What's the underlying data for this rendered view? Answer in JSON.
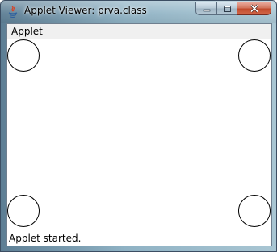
{
  "window": {
    "title": "Applet Viewer: prva.class",
    "app_icon": "java-icon",
    "controls": {
      "minimize_icon": "minimize-icon",
      "maximize_icon": "maximize-icon",
      "close_icon": "close-icon"
    }
  },
  "menubar": {
    "items": [
      {
        "label": "Applet"
      }
    ]
  },
  "applet": {
    "shapes": [
      {
        "name": "circle-top-left"
      },
      {
        "name": "circle-top-right"
      },
      {
        "name": "circle-bottom-left"
      },
      {
        "name": "circle-bottom-right"
      }
    ]
  },
  "status": {
    "text": "Applet started."
  },
  "colors": {
    "titlebar_start": "#5d7e94",
    "titlebar_end": "#a9c6d3",
    "close_button": "#c14a2c",
    "menubar_bg": "#f0f0f0",
    "canvas_bg": "#ffffff"
  }
}
